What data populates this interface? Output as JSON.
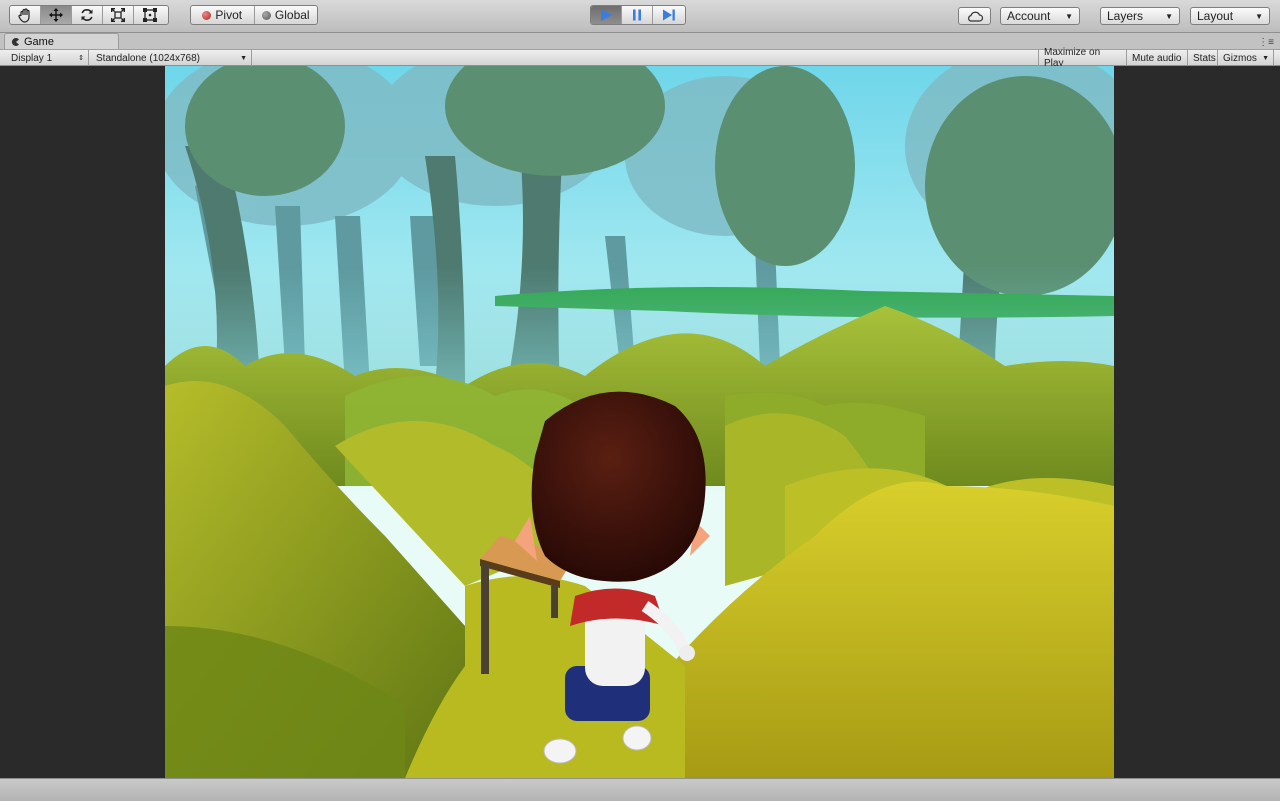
{
  "toolbar": {
    "pivot_label": "Pivot",
    "global_label": "Global",
    "account_label": "Account",
    "layers_label": "Layers",
    "layout_label": "Layout"
  },
  "tab": {
    "title": "Game"
  },
  "gamebar": {
    "display": "Display 1",
    "resolution": "Standalone (1024x768)",
    "maximize": "Maximize on Play",
    "mute": "Mute audio",
    "stats": "Stats",
    "gizmos": "Gizmos"
  },
  "icons": [
    "hand-icon",
    "move-icon",
    "rotate-icon",
    "scale-icon",
    "rect-icon",
    "play-icon",
    "pause-icon",
    "step-icon",
    "cloud-icon",
    "chevron-down-icon"
  ],
  "colors": {
    "accent": "#3a7de0",
    "sky": "#8fe3ee",
    "grass": "#c9c22a",
    "panel": "#c2c2c2"
  }
}
